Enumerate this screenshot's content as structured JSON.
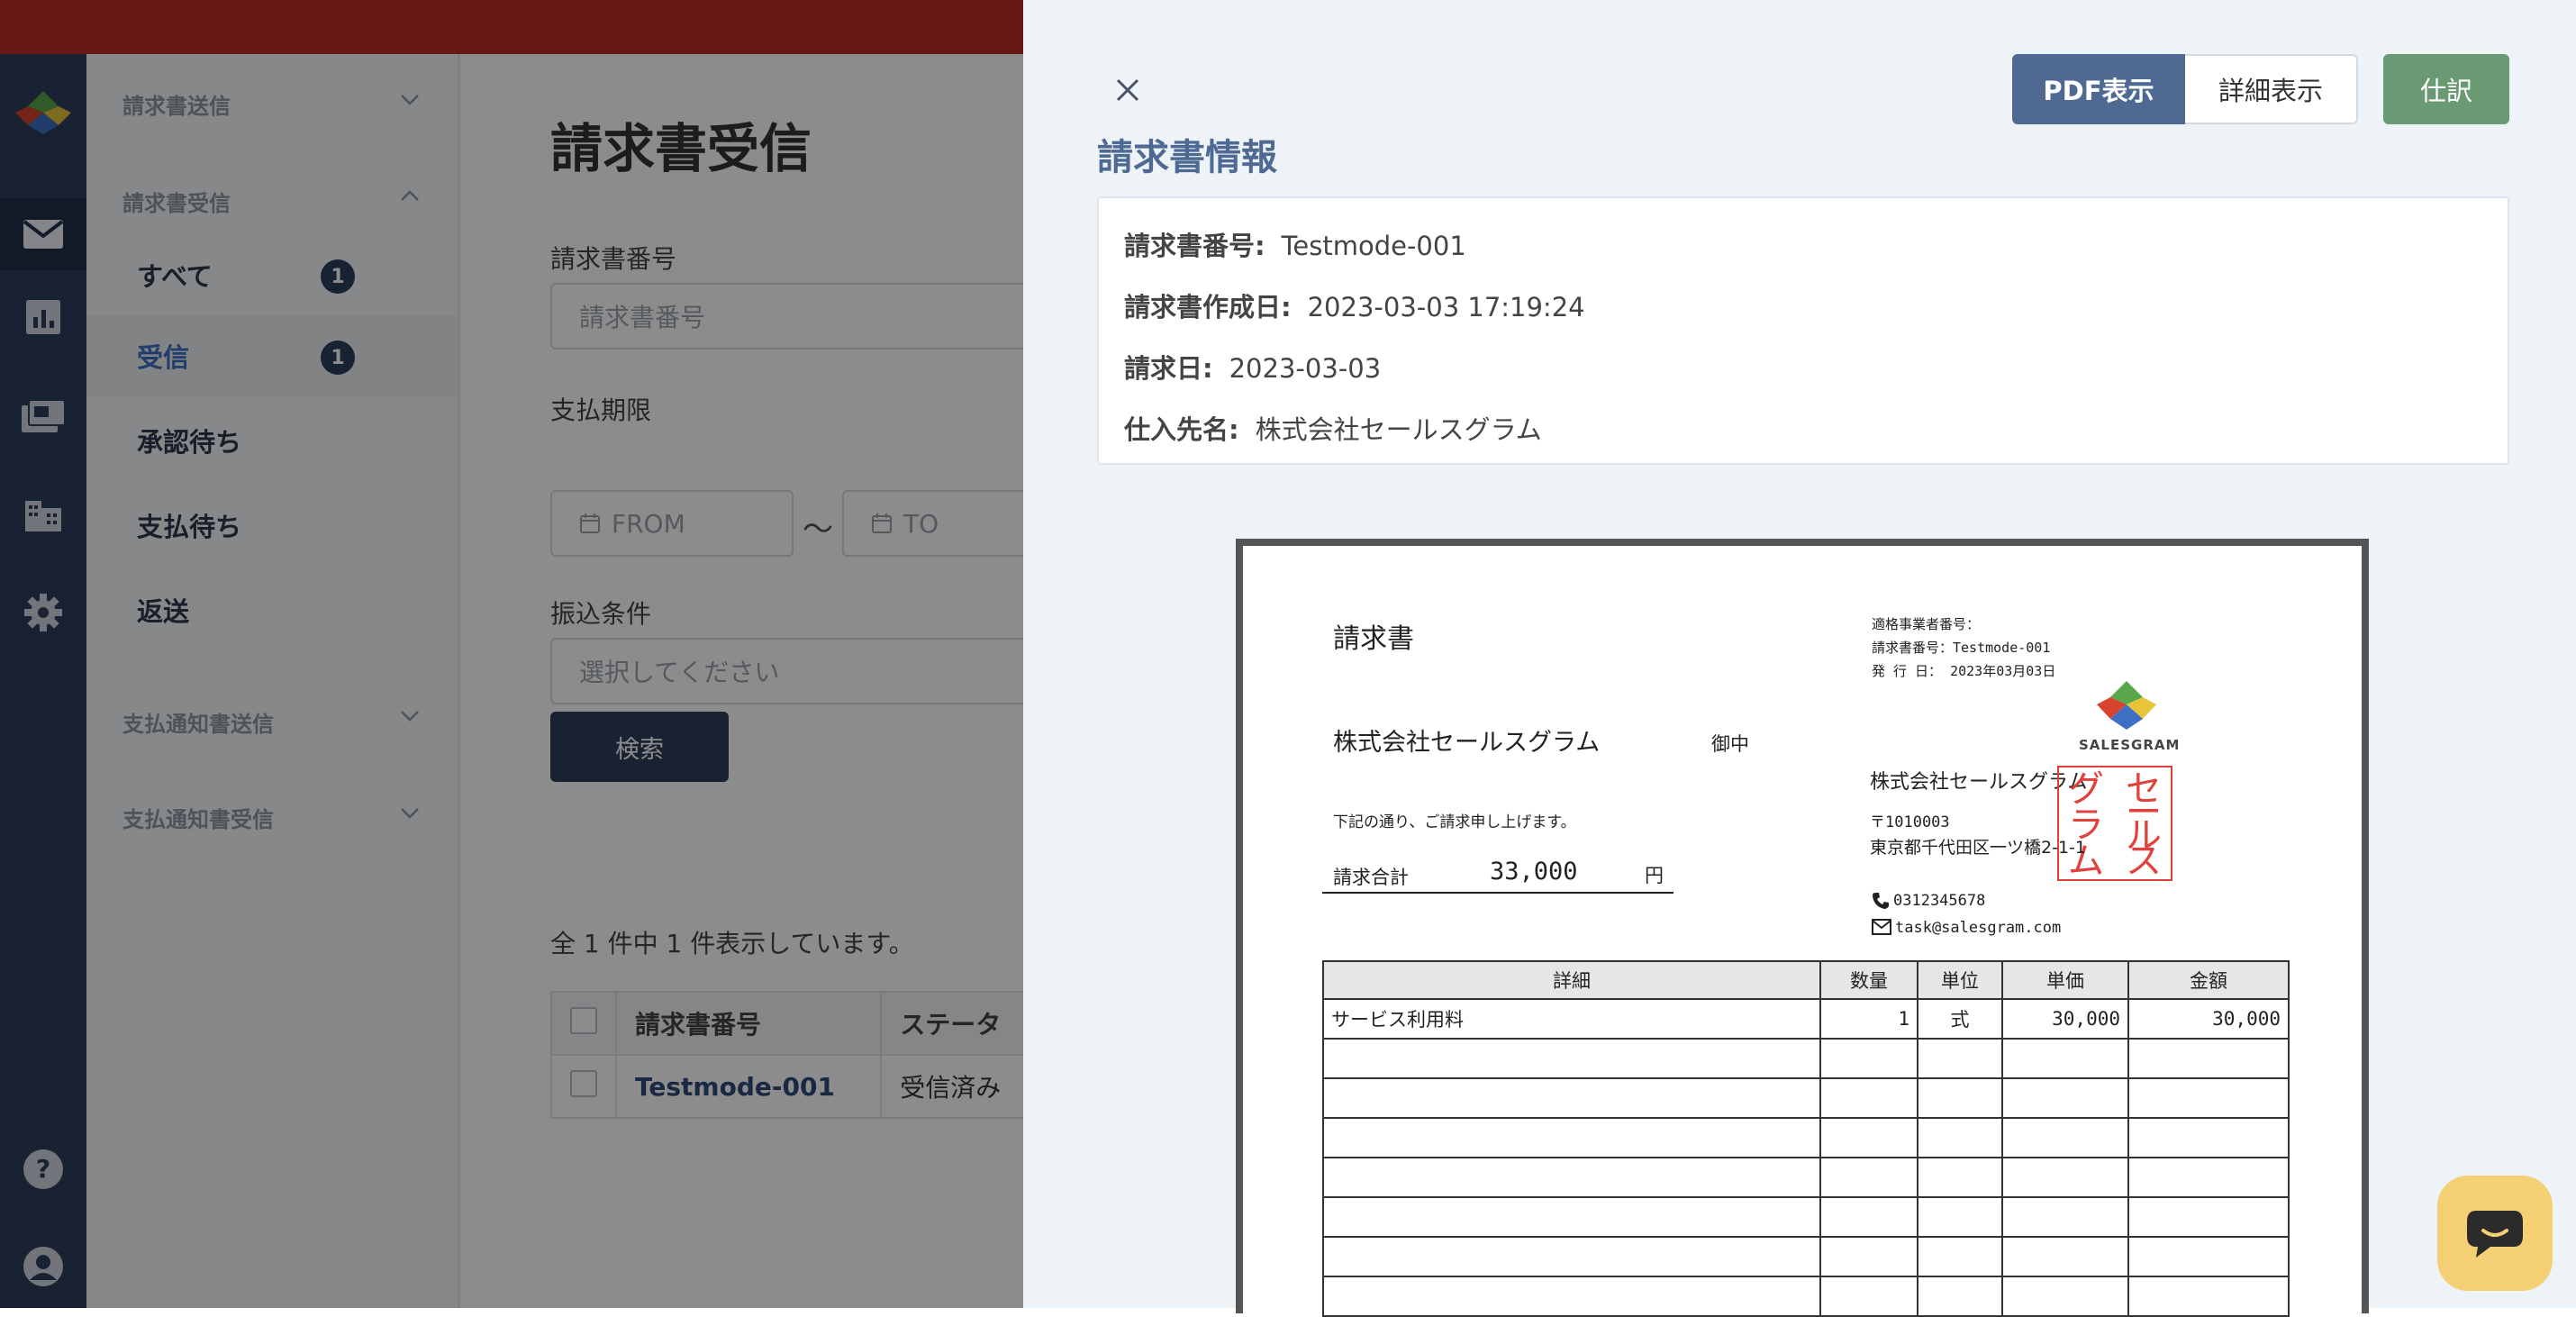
{
  "sidebar": {
    "groups": [
      {
        "label": "請求書送信"
      },
      {
        "label": "請求書受信"
      },
      {
        "label": "支払通知書送信"
      },
      {
        "label": "支払通知書受信"
      }
    ],
    "items": [
      {
        "label": "すべて",
        "badge": "1"
      },
      {
        "label": "受信",
        "badge": "1"
      },
      {
        "label": "承認待ち"
      },
      {
        "label": "支払待ち"
      },
      {
        "label": "返送"
      }
    ]
  },
  "main": {
    "title": "請求書受信",
    "invoice_no_label": "請求書番号",
    "invoice_no_placeholder": "請求書番号",
    "due_label": "支払期限",
    "from_placeholder": "FROM",
    "tilde": "〜",
    "to_placeholder": "TO",
    "transfer_label": "振込条件",
    "transfer_placeholder": "選択してください",
    "search_label": "検索",
    "count_text": "全 1 件中 1 件表示しています。",
    "table": {
      "headers": [
        "請求書番号",
        "ステータ"
      ],
      "rows": [
        {
          "invoice_no": "Testmode-001",
          "status": "受信済み"
        }
      ]
    }
  },
  "drawer": {
    "pdf_view_label": "PDF表示",
    "detail_view_label": "詳細表示",
    "journal_label": "仕訳",
    "title": "請求書情報",
    "info": [
      {
        "label": "請求書番号:",
        "value": "Testmode-001"
      },
      {
        "label": "請求書作成日:",
        "value": "2023-03-03 17:19:24"
      },
      {
        "label": "請求日:",
        "value": "2023-03-03"
      },
      {
        "label": "仕入先名:",
        "value": "株式会社セールスグラム"
      }
    ]
  },
  "pdf": {
    "doc_title": "請求書",
    "registration_no": "適格事業者番号：",
    "invoice_no_line": "請求書番号：Testmode-001",
    "issue_date_line": "発 行 日： 2023年03月03日",
    "recipient": "株式会社セールスグラム",
    "honorific": "御中",
    "message": "下記の通り、ご請求申し上げます。",
    "total_label": "請求合計",
    "total_value": "33,000",
    "total_unit": "円",
    "logo_text": "SALESGRAM",
    "sender_company": "株式会社セールスグラム",
    "postal": "〒1010003",
    "address": "東京都千代田区一ツ橋2-1-1",
    "phone": "0312345678",
    "email": "task@salesgram.com",
    "stamp_chars": [
      "セ",
      "ー",
      "ル",
      "ス",
      "グ",
      "ラ",
      "ム"
    ],
    "table": {
      "headers": [
        "詳細",
        "数量",
        "単位",
        "単価",
        "金額"
      ],
      "rows": [
        {
          "detail": "サービス利用料",
          "qty": "1",
          "unit": "式",
          "price": "30,000",
          "amount": "30,000"
        }
      ]
    }
  },
  "colors": {
    "topbar": "#c0282a",
    "rail": "#2e3e5c",
    "accent_blue": "#4f6a92",
    "journal_green": "#6a9a73",
    "stamp_red": "#e2403a",
    "chat": "#f5cf73"
  },
  "icons": [
    "app-logo-icon",
    "mail-icon",
    "chart-icon",
    "invoice-icon",
    "building-icon",
    "gear-icon",
    "help-icon",
    "user-icon",
    "close-icon",
    "calendar-icon",
    "chat-icon",
    "phone-icon",
    "envelope-icon"
  ]
}
